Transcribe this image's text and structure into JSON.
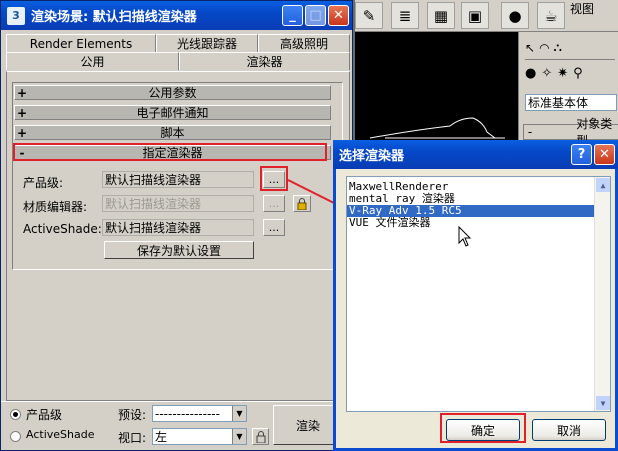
{
  "render_scene": {
    "title": "渲染场景: 默认扫描线渲染器",
    "tabs_row1": [
      "Render Elements",
      "光线跟踪器",
      "高级照明"
    ],
    "tabs_row2": [
      "公用",
      "渲染器"
    ],
    "rollouts": [
      {
        "sign": "+",
        "title": "公用参数"
      },
      {
        "sign": "+",
        "title": "电子邮件通知"
      },
      {
        "sign": "+",
        "title": "脚本"
      },
      {
        "sign": "-",
        "title": "指定渲染器"
      }
    ],
    "rows": [
      {
        "label": "产品级:",
        "value": "默认扫描线渲染器"
      },
      {
        "label": "材质编辑器:",
        "value": "默认扫描线渲染器"
      },
      {
        "label": "ActiveShade:",
        "value": "默认扫描线渲染器"
      }
    ],
    "dots_label": "...",
    "save_default": "保存为默认设置",
    "bottom": {
      "radio_production": "产品级",
      "radio_activeshade": "ActiveShade",
      "preset_label": "预设:",
      "preset_value": "---------------",
      "viewport_label": "视口:",
      "viewport_value": "左",
      "render_button": "渲染"
    }
  },
  "select_renderer": {
    "title": "选择渲染器",
    "items": [
      "MaxwellRenderer",
      "mental ray 渲染器",
      "V-Ray Adv 1.5 RC5",
      "VUE 文件渲染器"
    ],
    "selected_index": 2,
    "ok": "确定",
    "cancel": "取消"
  },
  "background": {
    "view_tab": "视图",
    "standard_primitives": "标准基本体",
    "object_type": "对象类型",
    "collapse_sign": "-"
  },
  "colors": {
    "highlight_red": "#e0202a",
    "selection_blue": "#316ac5",
    "xp_title_blue": "#0548c8"
  }
}
